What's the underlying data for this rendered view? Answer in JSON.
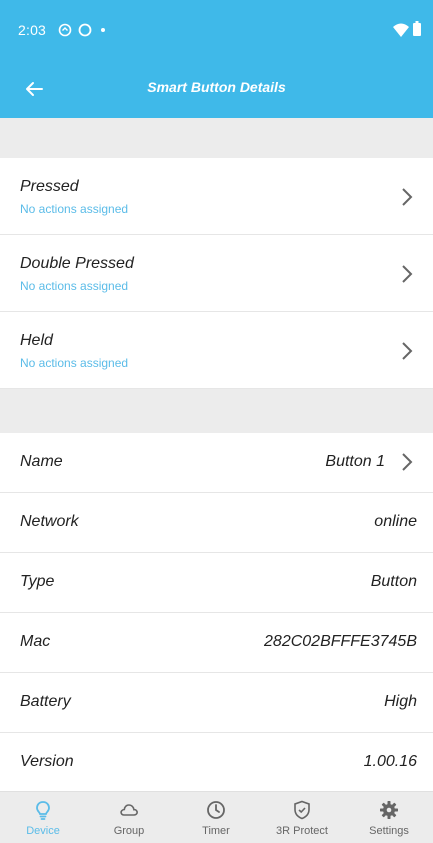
{
  "status_bar": {
    "time": "2:03"
  },
  "app_bar": {
    "title": "Smart Button Details"
  },
  "actions": [
    {
      "label": "Pressed",
      "status": "No actions assigned"
    },
    {
      "label": "Double Pressed",
      "status": "No actions assigned"
    },
    {
      "label": "Held",
      "status": "No actions assigned"
    }
  ],
  "details": [
    {
      "label": "Name",
      "value": "Button 1"
    },
    {
      "label": "Network",
      "value": "online"
    },
    {
      "label": "Type",
      "value": "Button"
    },
    {
      "label": "Mac",
      "value": "282C02BFFFE3745B"
    },
    {
      "label": "Battery",
      "value": "High"
    },
    {
      "label": "Version",
      "value": "1.00.16"
    }
  ],
  "bottom_nav": [
    {
      "label": "Device",
      "icon": "lightbulb-icon",
      "active": true
    },
    {
      "label": "Group",
      "icon": "cloud-icon",
      "active": false
    },
    {
      "label": "Timer",
      "icon": "clock-icon",
      "active": false
    },
    {
      "label": "3R Protect",
      "icon": "shield-icon",
      "active": false
    },
    {
      "label": "Settings",
      "icon": "gear-icon",
      "active": false
    }
  ],
  "colors": {
    "primary": "#3fb9e9",
    "accent_text": "#5bbce8",
    "background": "#ececec"
  }
}
